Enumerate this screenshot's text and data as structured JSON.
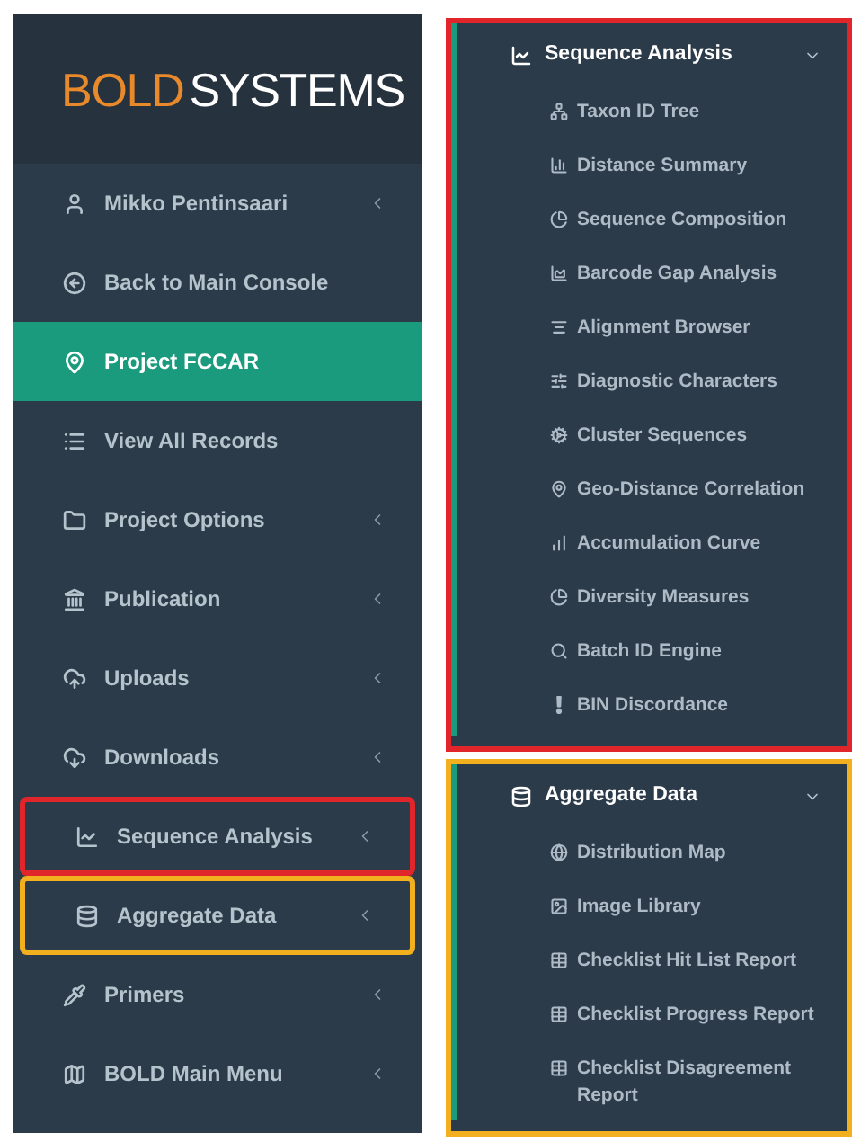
{
  "sidebar": {
    "logo": {
      "first": "BOLD",
      "second": "SYSTEMS"
    },
    "items": [
      {
        "label": "Mikko Pentinsaari",
        "caret": true,
        "selected": false
      },
      {
        "label": "Back to Main Console",
        "caret": false,
        "selected": false
      },
      {
        "label": "Project FCCAR",
        "caret": false,
        "selected": true
      },
      {
        "label": "View All Records",
        "caret": false,
        "selected": false
      },
      {
        "label": "Project Options",
        "caret": true,
        "selected": false
      },
      {
        "label": "Publication",
        "caret": true,
        "selected": false
      },
      {
        "label": "Uploads",
        "caret": true,
        "selected": false
      },
      {
        "label": "Downloads",
        "caret": true,
        "selected": false
      },
      {
        "label": "Sequence Analysis",
        "caret": true,
        "selected": false,
        "color": "#e0262b"
      },
      {
        "label": "Aggregate Data",
        "caret": true,
        "selected": false,
        "color": "#f2b01e"
      },
      {
        "label": "Primers",
        "caret": true,
        "selected": false
      },
      {
        "label": "BOLD Main Menu",
        "caret": true,
        "selected": false
      }
    ]
  },
  "submenus": [
    {
      "title": "Sequence Analysis",
      "expanded": true,
      "color": "#e0262b",
      "items": [
        "Taxon ID Tree",
        "Distance Summary",
        "Sequence Composition",
        "Barcode Gap Analysis",
        "Alignment Browser",
        "Diagnostic Characters",
        "Cluster Sequences",
        "Geo-Distance Correlation",
        "Accumulation Curve",
        "Diversity Measures",
        "Batch ID Engine",
        "BIN Discordance"
      ]
    },
    {
      "title": "Aggregate Data",
      "expanded": true,
      "color": "#f2b01e",
      "items": [
        "Distribution Map",
        "Image Library",
        "Checklist Hit List Report",
        "Checklist Progress Report",
        "Checklist Disagreement Report"
      ]
    }
  ]
}
